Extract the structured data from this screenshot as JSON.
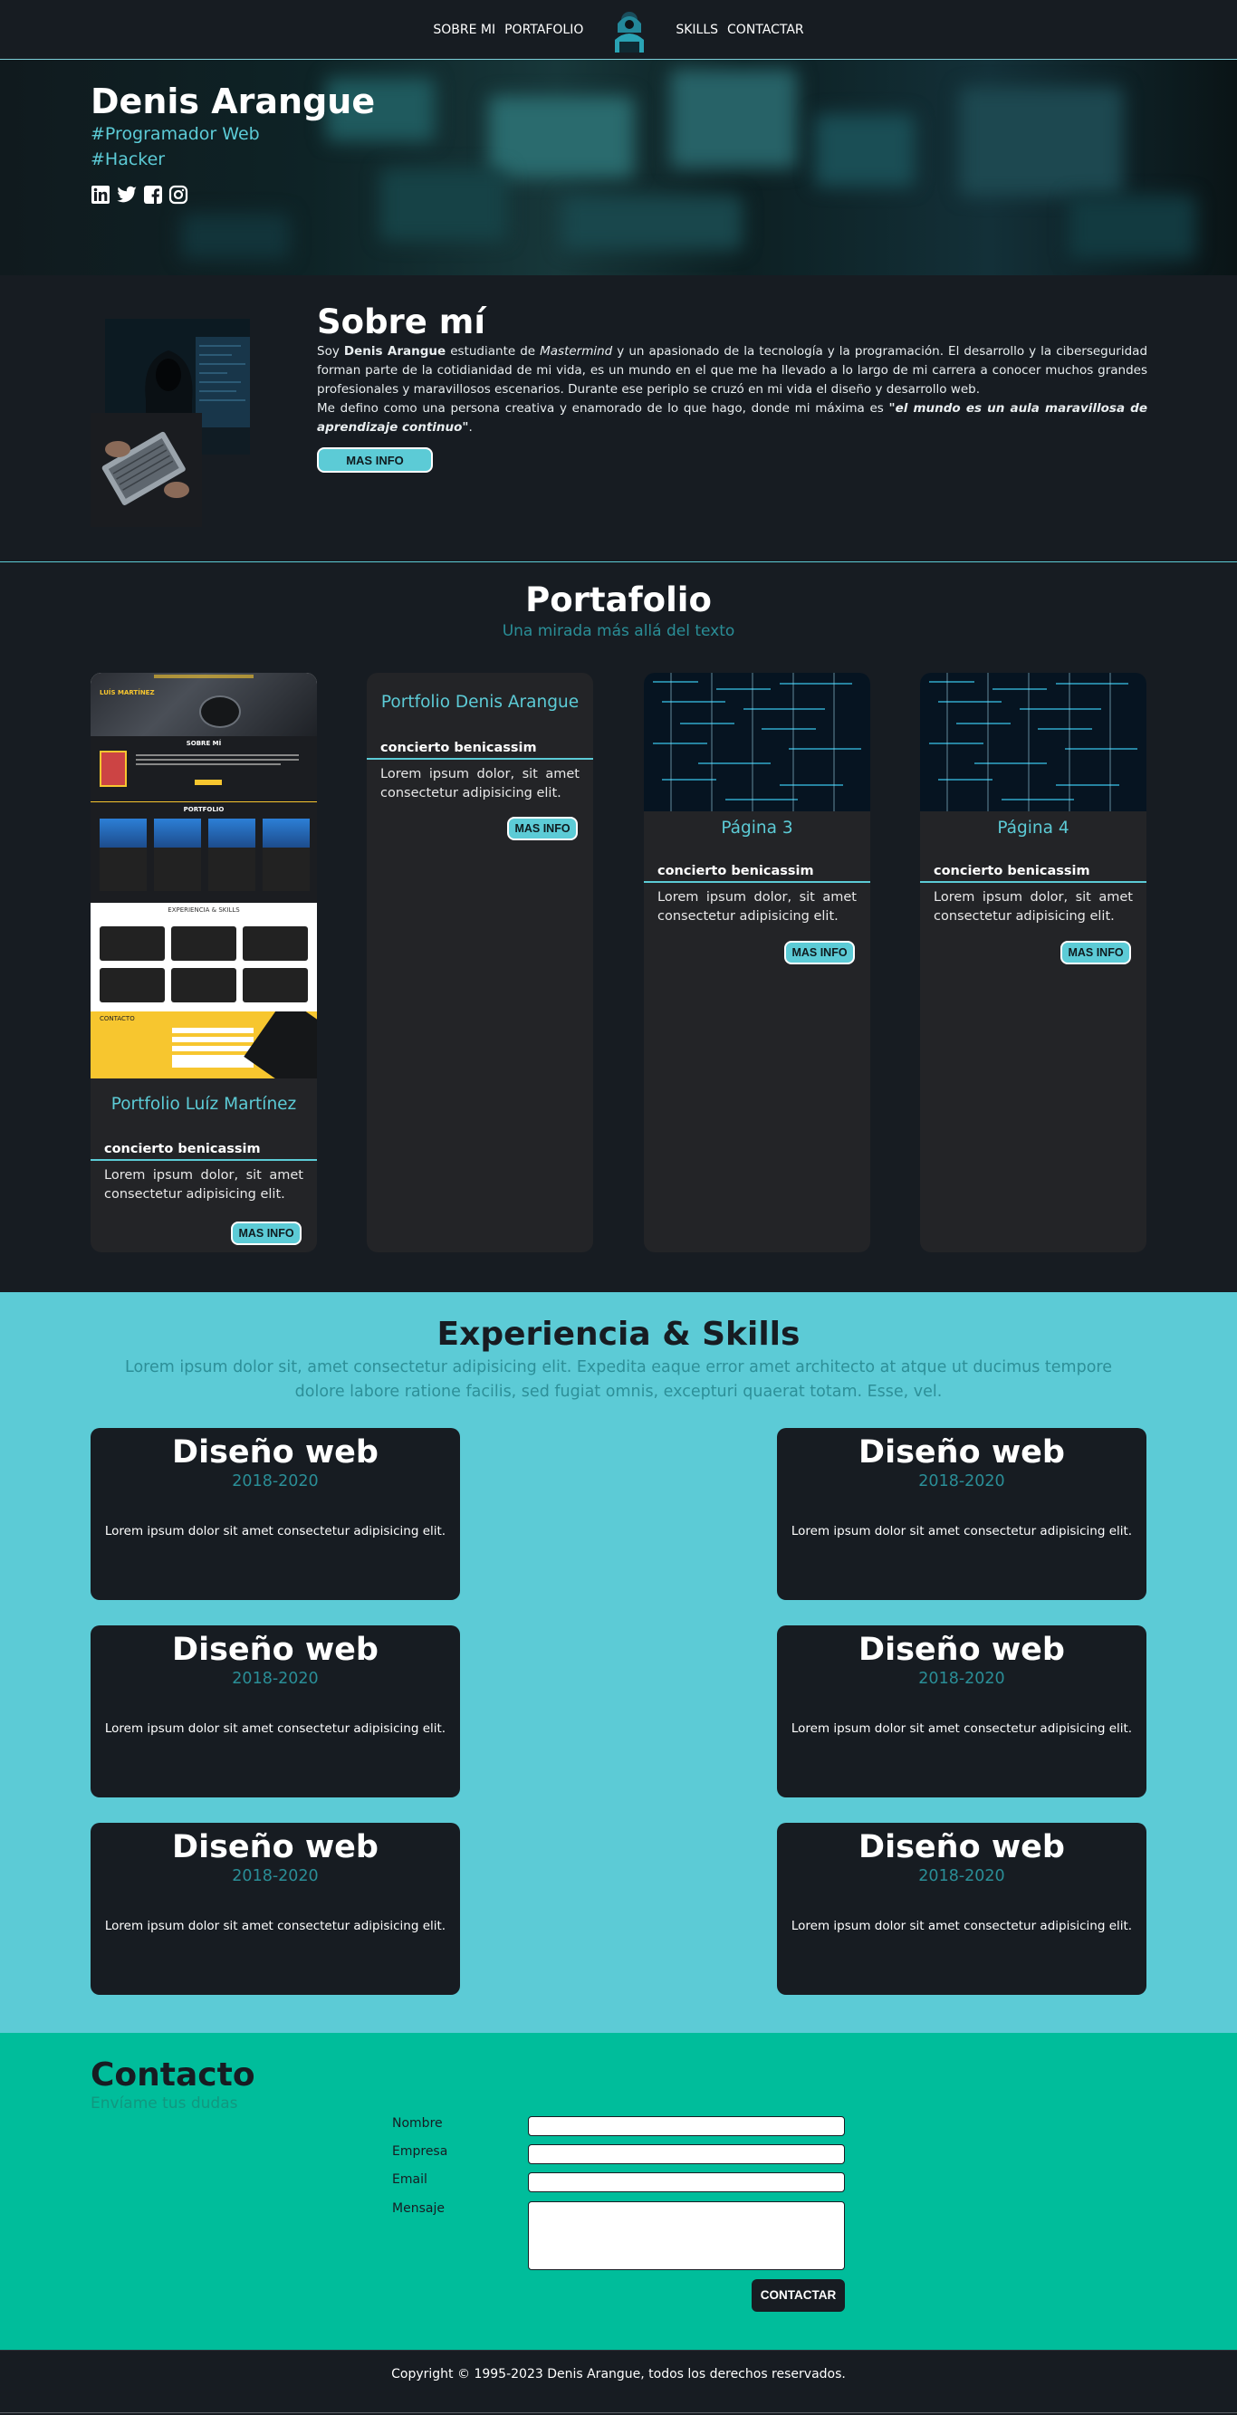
{
  "nav": {
    "links_left": [
      "SOBRE MI",
      "PORTAFOLIO"
    ],
    "links_right": [
      "SKILLS",
      "CONTACTAR"
    ]
  },
  "hero": {
    "name": "Denis Arangue",
    "tag1": "#Programador Web",
    "tag2": "#Hacker",
    "social": [
      "linkedin-icon",
      "twitter-icon",
      "facebook-icon",
      "instagram-icon"
    ]
  },
  "about": {
    "title": "Sobre mí",
    "p1_a": "Soy ",
    "p1_name": "Denis Arangue",
    "p1_b": " estudiante de ",
    "p1_school": "Mastermind",
    "p1_c": " y un apasionado de la tecnología y la programación. El desarrollo y la ciberseguridad forman parte de la cotidianidad de mi vida, es un mundo en el que me ha llevado a lo largo de mi carrera a conocer muchos grandes profesionales y maravillosos escenarios. Durante ese periplo se cruzó en mi vida el diseño y desarrollo web.",
    "p2_a": "Me defino como una persona creativa y enamorado de lo que hago, donde mi máxima es ",
    "p2_quote": "\"el mundo es un aula maravillosa de aprendizaje continuo\"",
    "p2_b": ".",
    "button": "MAS INFO"
  },
  "portfolio": {
    "title": "Portafolio",
    "subtitle": "Una mirada más allá del texto",
    "cards": [
      {
        "title": "Portfolio Luíz Martínez",
        "head": "concierto benicassim",
        "text": "Lorem ipsum dolor, sit amet consectetur adipisicing elit.",
        "button": "MAS INFO"
      },
      {
        "title": "Portfolio Denis Arangue",
        "head": "concierto benicassim",
        "text": "Lorem ipsum dolor, sit amet consectetur adipisicing elit.",
        "button": "MAS INFO"
      },
      {
        "title": "Página 3",
        "head": "concierto benicassim",
        "text": "Lorem ipsum dolor, sit amet consectetur adipisicing elit.",
        "button": "MAS INFO"
      },
      {
        "title": "Página 4",
        "head": "concierto benicassim",
        "text": "Lorem ipsum dolor, sit amet consectetur adipisicing elit.",
        "button": "MAS INFO"
      }
    ],
    "thumb": {
      "name": "LUÍS MARTÍNEZ",
      "about": "SOBRE MÍ",
      "portfolio": "PORTFOLIO",
      "exp": "EXPERIENCIA & SKILLS",
      "contact": "CONTACTO"
    }
  },
  "skills": {
    "title": "Experiencia & Skills",
    "subtitle": "Lorem ipsum dolor sit, amet consectetur adipisicing elit. Expedita eaque error amet architecto at atque ut ducimus tempore dolore labore ratione facilis, sed fugiat omnis, excepturi quaerat totam. Esse, vel.",
    "cards": [
      {
        "title": "Diseño web",
        "years": "2018-2020",
        "desc": "Lorem ipsum dolor sit amet consectetur adipisicing elit."
      },
      {
        "title": "Diseño web",
        "years": "2018-2020",
        "desc": "Lorem ipsum dolor sit amet consectetur adipisicing elit."
      },
      {
        "title": "Diseño web",
        "years": "2018-2020",
        "desc": "Lorem ipsum dolor sit amet consectetur adipisicing elit."
      },
      {
        "title": "Diseño web",
        "years": "2018-2020",
        "desc": "Lorem ipsum dolor sit amet consectetur adipisicing elit."
      },
      {
        "title": "Diseño web",
        "years": "2018-2020",
        "desc": "Lorem ipsum dolor sit amet consectetur adipisicing elit."
      },
      {
        "title": "Diseño web",
        "years": "2018-2020",
        "desc": "Lorem ipsum dolor sit amet consectetur adipisicing elit."
      }
    ]
  },
  "contact": {
    "title": "Contacto",
    "subtitle": "Envíame tus dudas",
    "labels": [
      "Nombre",
      "Empresa",
      "Email",
      "Mensaje"
    ],
    "button": "CONTACTAR"
  },
  "footer": {
    "text": "Copyright © 1995-2023 Denis Arangue, todos los derechos reservados."
  },
  "colors": {
    "accent": "#5ccbd6",
    "dark": "#171c22",
    "contact_bg": "#00bd9b"
  }
}
